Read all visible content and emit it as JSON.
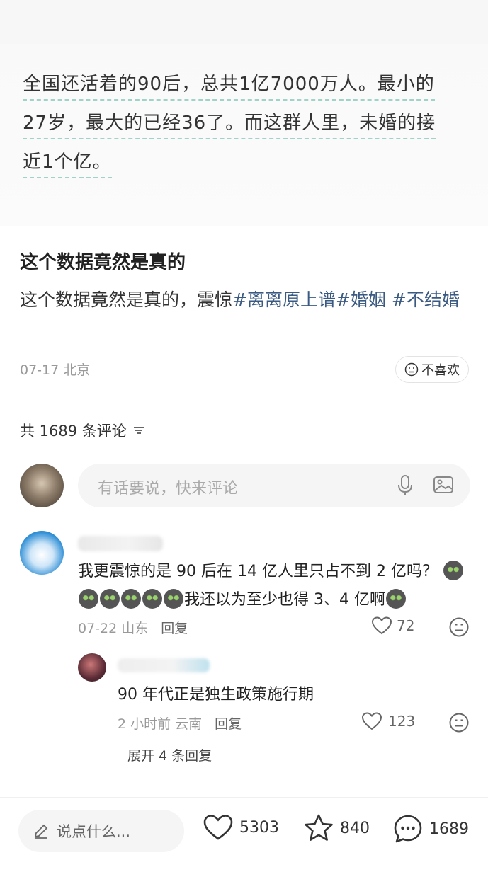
{
  "image_text": {
    "line1": "全国还活着的90后，总共1亿7000万人。最小的",
    "line2": "27岁，最大的已经36了。而这群人里，未婚的接",
    "line3": "近1个亿。"
  },
  "note": {
    "title": "这个数据竟然是真的",
    "body_text": "这个数据竟然是真的，震惊",
    "tags": [
      "#离离原上谱",
      "#婚姻",
      " #不结婚"
    ],
    "date_location": "07-17 北京",
    "dislike_label": "不喜欢"
  },
  "comments_header": {
    "count_label": "共 1689 条评论"
  },
  "comment_input": {
    "placeholder": "有话要说，快来评论"
  },
  "comments": [
    {
      "text_part1": "我更震惊的是 90 后在 14 亿人里只占不到 2 亿吗？",
      "text_part2": "我还以为至少也得 3、4 亿啊",
      "meta": "07-22 山东",
      "reply_label": "回复",
      "likes": "72"
    },
    {
      "text": "90 年代正是独生政策施行期",
      "meta": "2 小时前 云南",
      "reply_label": "回复",
      "likes": "123"
    }
  ],
  "expand_label": "展开 4 条回复",
  "bottom_bar": {
    "input_placeholder": "说点什么...",
    "likes": "5303",
    "favorites": "840",
    "comments": "1689"
  },
  "icons": {
    "heart": "heart-icon",
    "star": "star-icon",
    "comment": "comment-bubble-icon",
    "mic": "mic-icon",
    "image": "image-icon",
    "dislike": "dislike-face-icon",
    "pencil": "pencil-icon",
    "sort": "sort-icon"
  },
  "colors": {
    "tag": "#3a5a82",
    "muted": "#999999",
    "input_bg": "#f5f5f5"
  }
}
